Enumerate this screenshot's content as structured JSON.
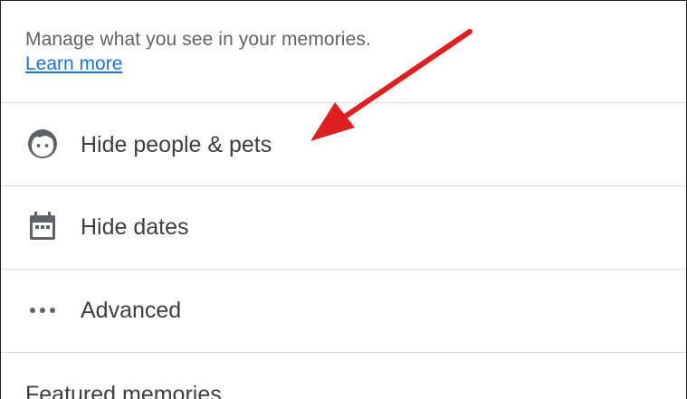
{
  "header": {
    "description": "Manage what you see in your memories.",
    "learn_more": "Learn more"
  },
  "rows": [
    {
      "label": "Hide people & pets",
      "icon": "face-icon"
    },
    {
      "label": "Hide dates",
      "icon": "calendar-icon"
    },
    {
      "label": "Advanced",
      "icon": "more-horiz-icon"
    }
  ],
  "section": {
    "title": "Featured memories"
  },
  "colors": {
    "link": "#1a73e8",
    "text": "#3c4043",
    "secondary_text": "#5f6368",
    "divider": "#dadce0",
    "icon": "#5f6368",
    "annotation_arrow": "#e02020"
  }
}
